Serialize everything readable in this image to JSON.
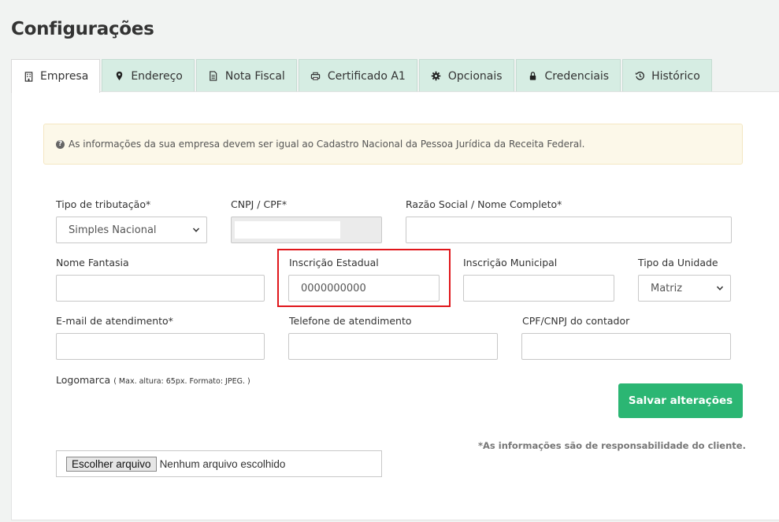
{
  "page": {
    "title": "Configurações"
  },
  "tabs": [
    {
      "label": "Empresa",
      "icon": "building-icon",
      "active": true
    },
    {
      "label": "Endereço",
      "icon": "map-marker-icon"
    },
    {
      "label": "Nota Fiscal",
      "icon": "document-icon"
    },
    {
      "label": "Certificado A1",
      "icon": "printer-icon"
    },
    {
      "label": "Opcionais",
      "icon": "gear-icon"
    },
    {
      "label": "Credenciais",
      "icon": "lock-icon"
    },
    {
      "label": "Histórico",
      "icon": "history-icon"
    }
  ],
  "alert": {
    "text": "As informações da sua empresa devem ser igual ao Cadastro Nacional da Pessoa Jurídica da Receita Federal."
  },
  "form": {
    "tipo_tributacao": {
      "label": "Tipo de tributação*",
      "value": "Simples Nacional"
    },
    "cnpj_cpf": {
      "label": "CNPJ / CPF*",
      "value": ""
    },
    "razao_social": {
      "label": "Razão Social / Nome Completo*",
      "value": ""
    },
    "nome_fantasia": {
      "label": "Nome Fantasia",
      "value": ""
    },
    "inscricao_estadual": {
      "label": "Inscrição Estadual",
      "value": "0000000000"
    },
    "inscricao_municipal": {
      "label": "Inscrição Municipal",
      "value": ""
    },
    "tipo_unidade": {
      "label": "Tipo da Unidade",
      "value": "Matriz"
    },
    "email_atendimento": {
      "label": "E-mail de atendimento*",
      "value": ""
    },
    "telefone_atendimento": {
      "label": "Telefone de atendimento",
      "value": ""
    },
    "cpf_cnpj_contador": {
      "label": "CPF/CNPJ do contador",
      "value": ""
    },
    "logomarca": {
      "label": "Logomarca",
      "hint": "( Max. altura: 65px. Formato: JPEG. )"
    },
    "file": {
      "button": "Escolher arquivo",
      "status": "Nenhum arquivo escolhido"
    }
  },
  "actions": {
    "save_label": "Salvar alterações"
  },
  "note": "*As informações são de responsabilidade do cliente.",
  "colors": {
    "save": "#2bb673",
    "tab_bg": "#d6ede3",
    "highlight": "#e0161b",
    "alert_bg": "#fcf8e9"
  }
}
